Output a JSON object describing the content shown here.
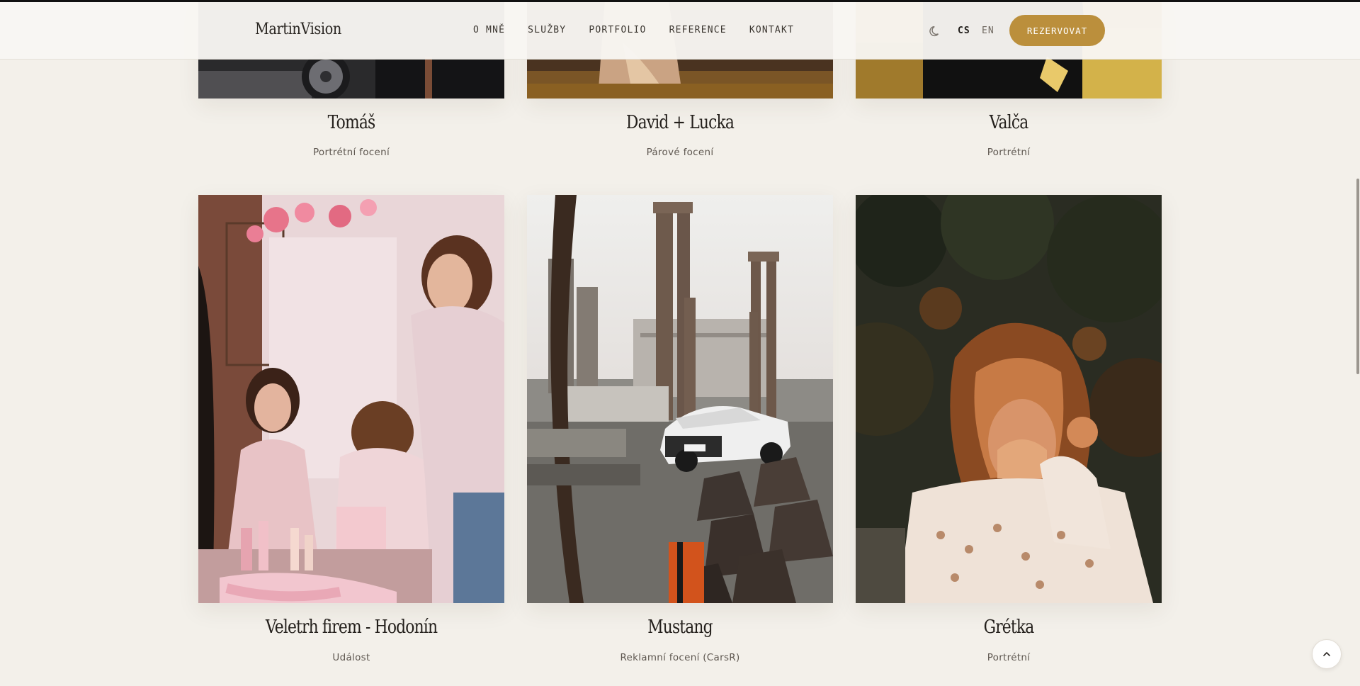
{
  "brand": {
    "logo": "MartinVision"
  },
  "nav": {
    "items": [
      "O MNĚ",
      "SLUŽBY",
      "PORTFOLIO",
      "REFERENCE",
      "KONTAKT"
    ]
  },
  "lang": {
    "cs": "CS",
    "en": "EN"
  },
  "cta": {
    "label": "REZERVOVAT"
  },
  "colors": {
    "accent": "#bb8f3c",
    "background": "#f3f0ea"
  },
  "icons": {
    "theme": "moon-icon",
    "scroll_top": "chevron-up-icon"
  },
  "gallery": {
    "row1": [
      {
        "title": "Tomáš",
        "category": "Portrétní focení"
      },
      {
        "title": "David + Lucka",
        "category": "Párové focení"
      },
      {
        "title": "Valča",
        "category": "Portrétní"
      }
    ],
    "row2": [
      {
        "title": "Veletrh firem - Hodonín",
        "category": "Událost"
      },
      {
        "title": "Mustang",
        "category": "Reklamní focení (CarsR)"
      },
      {
        "title": "Grétka",
        "category": "Portrétní"
      }
    ]
  }
}
